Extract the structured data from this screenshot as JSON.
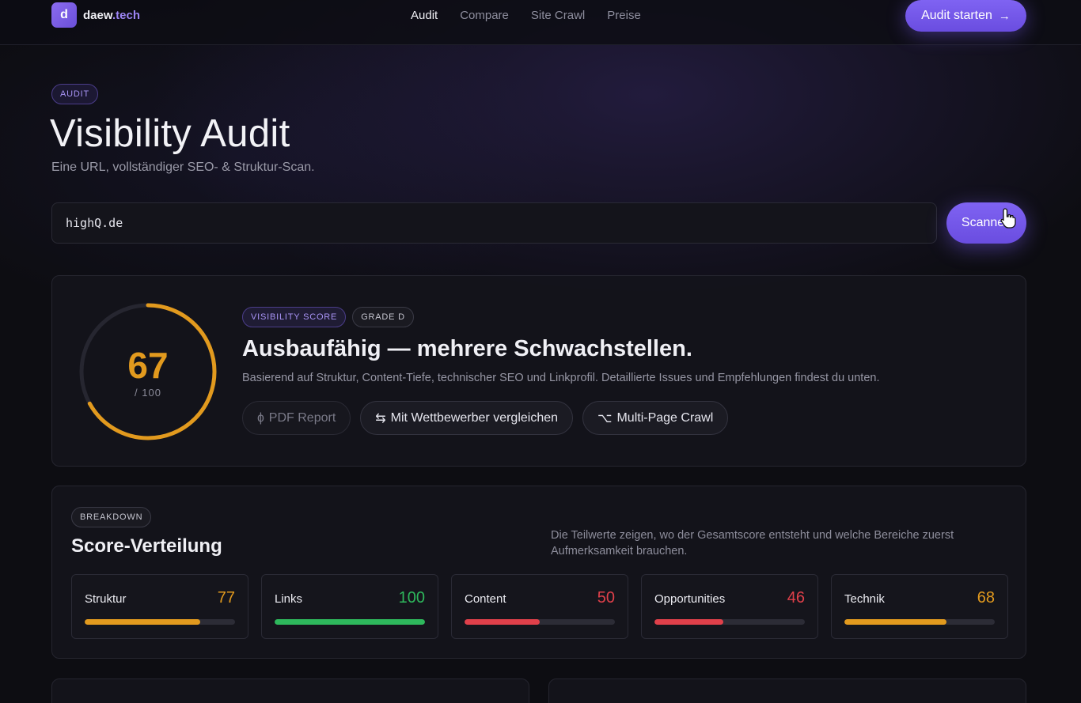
{
  "nav": {
    "logo_letter": "d",
    "logo_name": "daew",
    "logo_tld": ".tech",
    "links": [
      "Audit",
      "Compare",
      "Site Crawl",
      "Preise"
    ],
    "cta_label": "Audit starten",
    "cta_icon": "arrow-right-icon"
  },
  "header": {
    "pill": "AUDIT",
    "title": "Visibility Audit",
    "subtitle": "Eine URL, vollständiger SEO- & Struktur-Scan."
  },
  "scan": {
    "url_value": "highQ.de",
    "button_label": "Scannen"
  },
  "score": {
    "value": 67,
    "value_text": "67",
    "max_text": "/ 100",
    "gauge_color": "#e29a1e",
    "pill_score": "VISIBILITY SCORE",
    "pill_grade": "GRADE D",
    "headline": "Ausbaufähig — mehrere Schwachstellen.",
    "description": "Basierend auf Struktur, Content-Tiefe, technischer SEO und Linkprofil. Detaillierte Issues und Empfehlungen findest du unten.",
    "actions": [
      {
        "icon": "ɸ",
        "label": "PDF Report",
        "disabled": true
      },
      {
        "icon": "⇆",
        "label": "Mit Wettbewerber vergleichen",
        "disabled": false
      },
      {
        "icon": "⌥",
        "label": "Multi-Page Crawl",
        "disabled": false
      }
    ]
  },
  "breakdown": {
    "pill": "BREAKDOWN",
    "title": "Score-Verteilung",
    "note": "Die Teilwerte zeigen, wo der Gesamtscore entsteht und welche Bereiche zuerst Aufmerksamkeit brauchen.",
    "metrics": [
      {
        "label": "Struktur",
        "value": 77,
        "value_text": "77",
        "color": "#e29a1e"
      },
      {
        "label": "Links",
        "value": 100,
        "value_text": "100",
        "color": "#2eb85c"
      },
      {
        "label": "Content",
        "value": 50,
        "value_text": "50",
        "color": "#e0404a"
      },
      {
        "label": "Opportunities",
        "value": 46,
        "value_text": "46",
        "color": "#e0404a"
      },
      {
        "label": "Technik",
        "value": 68,
        "value_text": "68",
        "color": "#e29a1e"
      }
    ]
  }
}
